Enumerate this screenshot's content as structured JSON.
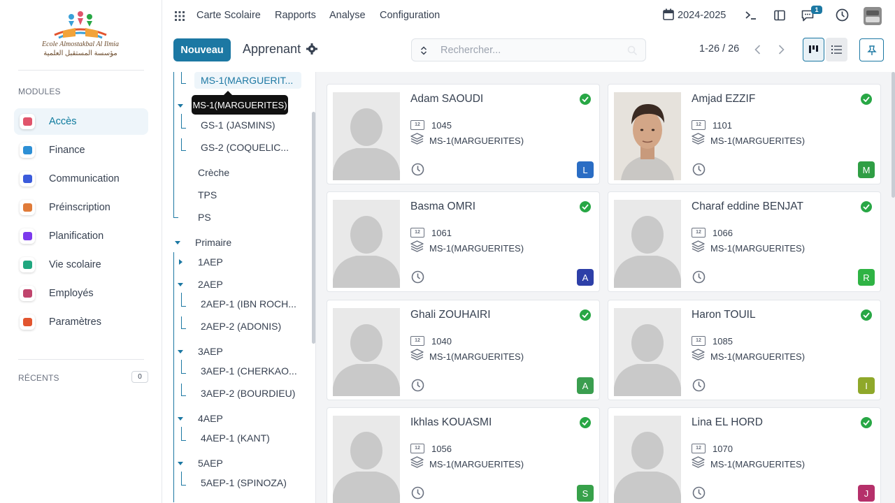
{
  "school": {
    "name_latin": "Ecole Almostakbal Al Ilmia",
    "name_arabic": "مؤسسة المستقبل العلمية"
  },
  "sidebar": {
    "modules_title": "MODULES",
    "modules": [
      {
        "label": "Accès",
        "icon": "access-icon",
        "color": "#e0546b"
      },
      {
        "label": "Finance",
        "icon": "finance-icon",
        "color": "#2d8fd5"
      },
      {
        "label": "Communication",
        "icon": "communication-icon",
        "color": "#3b5bdb"
      },
      {
        "label": "Préinscription",
        "icon": "preinscription-icon",
        "color": "#e07b39"
      },
      {
        "label": "Planification",
        "icon": "planning-icon",
        "color": "#7c3aed"
      },
      {
        "label": "Vie scolaire",
        "icon": "school-life-icon",
        "color": "#20a77f"
      },
      {
        "label": "Employés",
        "icon": "employees-icon",
        "color": "#c0456d"
      },
      {
        "label": "Paramètres",
        "icon": "settings-icon",
        "color": "#e2552f"
      }
    ],
    "active_module": "Accès",
    "recents_title": "RÉCENTS",
    "recents_count": "0"
  },
  "topnav": {
    "items": [
      "Carte Scolaire",
      "Rapports",
      "Analyse",
      "Configuration"
    ],
    "year": "2024-2025",
    "notif_count": "1"
  },
  "control": {
    "new_label": "Nouveau",
    "title": "Apprenant",
    "search_placeholder": "Rechercher...",
    "pager": "1-26 / 26"
  },
  "tree": {
    "selected": "MS-1(MARGUERIT...",
    "tooltip": "MS-1(MARGUERITES)",
    "nodes": [
      "GS-1 (JASMINS)",
      "GS-2 (COQUELIC...",
      "Crèche",
      "TPS",
      "PS",
      "Primaire",
      "1AEP",
      "2AEP",
      "2AEP-1 (IBN ROCH...",
      "2AEP-2 (ADONIS)",
      "3AEP",
      "3AEP-1 (CHERKAO...",
      "3AEP-2 (BOURDIEU)",
      "4AEP",
      "4AEP-1 (KANT)",
      "5AEP",
      "5AEP-1 (SPINOZA)"
    ]
  },
  "students": [
    {
      "name": "Adam SAOUDI",
      "id": "1045",
      "class": "MS-1(MARGUERITES)",
      "initial": "L",
      "color": "#2a6dc4",
      "photo": false
    },
    {
      "name": "Amjad EZZIF",
      "id": "1101",
      "class": "MS-1(MARGUERITES)",
      "initial": "M",
      "color": "#2f9e44",
      "photo": true
    },
    {
      "name": "Basma OMRI",
      "id": "1061",
      "class": "MS-1(MARGUERITES)",
      "initial": "A",
      "color": "#2d3fa8",
      "photo": false
    },
    {
      "name": "Charaf eddine BENJAT",
      "id": "1066",
      "class": "MS-1(MARGUERITES)",
      "initial": "R",
      "color": "#2fb344",
      "photo": false
    },
    {
      "name": "Ghali ZOUHAIRI",
      "id": "1040",
      "class": "MS-1(MARGUERITES)",
      "initial": "A",
      "color": "#3a9e4f",
      "photo": false
    },
    {
      "name": "Haron TOUIL",
      "id": "1085",
      "class": "MS-1(MARGUERITES)",
      "initial": "I",
      "color": "#8fa82a",
      "photo": false
    },
    {
      "name": "Ikhlas KOUASMI",
      "id": "1056",
      "class": "MS-1(MARGUERITES)",
      "initial": "S",
      "color": "#37a14a",
      "photo": false
    },
    {
      "name": "Lina EL HORD",
      "id": "1070",
      "class": "MS-1(MARGUERITES)",
      "initial": "J",
      "color": "#b5306a",
      "photo": false
    }
  ],
  "colors": {
    "primary": "#1c78a3",
    "success": "#28a745",
    "tree_line": "#1c78a3"
  }
}
